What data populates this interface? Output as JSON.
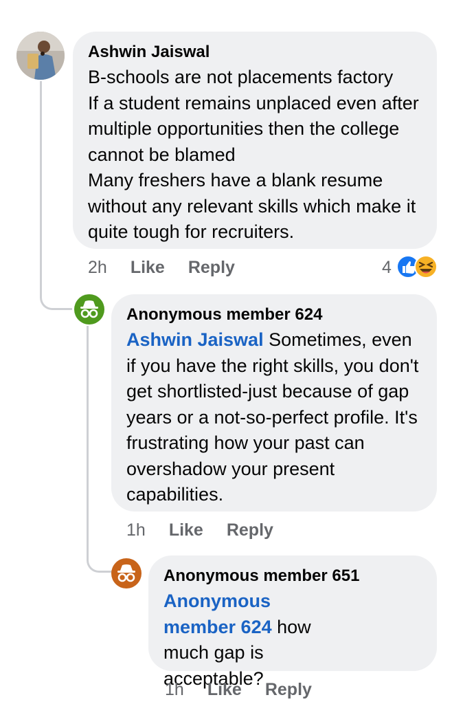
{
  "comments": [
    {
      "author": "Ashwin Jaiswal",
      "mention": "",
      "text": "B-schools are not placements factory\nIf a student remains unplaced even after multiple opportunities then the college cannot be blamed\nMany freshers have a blank resume without any relevant skills which make it quite tough for recruiters.",
      "time": "2h",
      "like": "Like",
      "reply": "Reply",
      "reaction_count": "4",
      "reactions": [
        "like-reaction-icon",
        "laugh-reaction-icon"
      ]
    },
    {
      "author": "Anonymous member 624",
      "mention": "Ashwin Jaiswal",
      "text": "Sometimes, even if you have the right skills, you don't get shortlisted-just because of gap years or a not-so-perfect profile. It's frustrating how your past can overshadow your present capabilities.",
      "time": "1h",
      "like": "Like",
      "reply": "Reply"
    },
    {
      "author": "Anonymous member 651",
      "mention": "Anonymous member 624",
      "text": "how much gap is acceptable?",
      "time": "1h",
      "like": "Like",
      "reply": "Reply"
    }
  ],
  "colors": {
    "bubble": "#eff0f2",
    "mention": "#1a63c4",
    "anon_green": "#4f9a1e",
    "anon_orange": "#c8641a",
    "like_blue": "#1877f2",
    "meta": "#65676b"
  }
}
